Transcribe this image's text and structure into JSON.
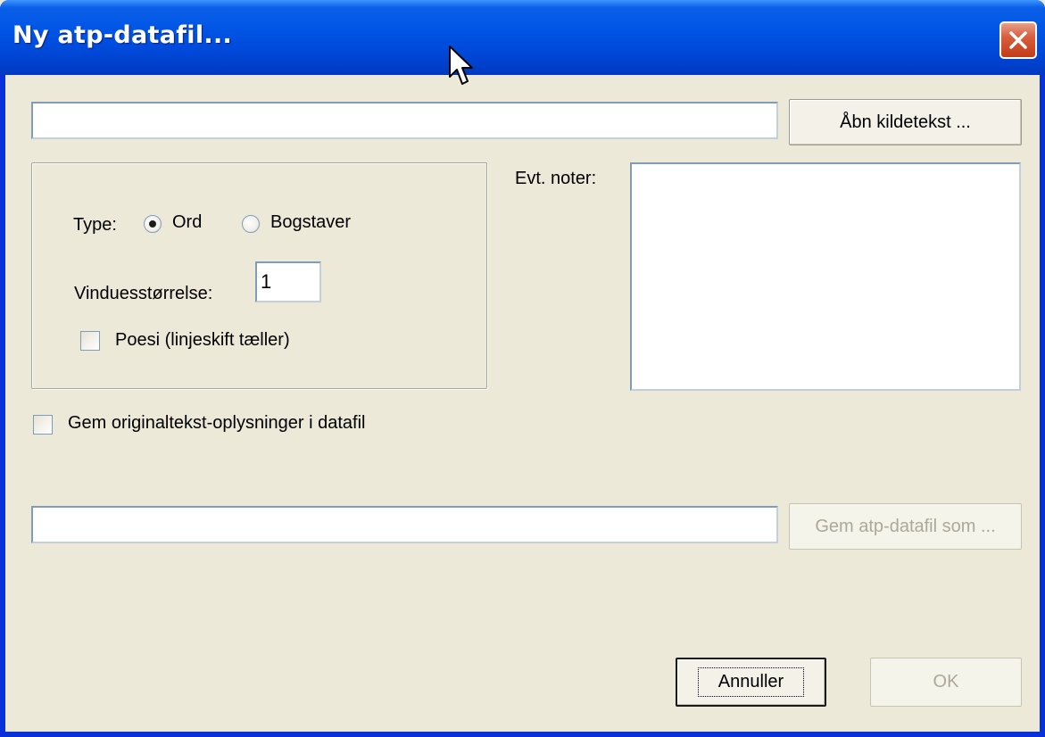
{
  "window": {
    "title": "Ny atp-datafil..."
  },
  "source": {
    "path_value": "",
    "open_button_label": "Åbn kildetekst ..."
  },
  "options": {
    "type_label": "Type:",
    "type_options": [
      {
        "label": "Ord",
        "selected": true
      },
      {
        "label": "Bogstaver",
        "selected": false
      }
    ],
    "window_size_label": "Vinduesstørrelse:",
    "window_size_value": "1",
    "poetry_label": "Poesi (linjeskift tæller)",
    "poetry_checked": false
  },
  "notes": {
    "label": "Evt. noter:",
    "value": ""
  },
  "save_original_label": "Gem originaltekst-oplysninger i datafil",
  "save_original_checked": false,
  "output": {
    "path_value": "",
    "save_button_label": "Gem atp-datafil som ..."
  },
  "footer": {
    "cancel_label": "Annuller",
    "ok_label": "OK"
  },
  "colors": {
    "titlebar": "#0055e5",
    "window_bg": "#ece9d8",
    "close_button": "#c23b18"
  }
}
